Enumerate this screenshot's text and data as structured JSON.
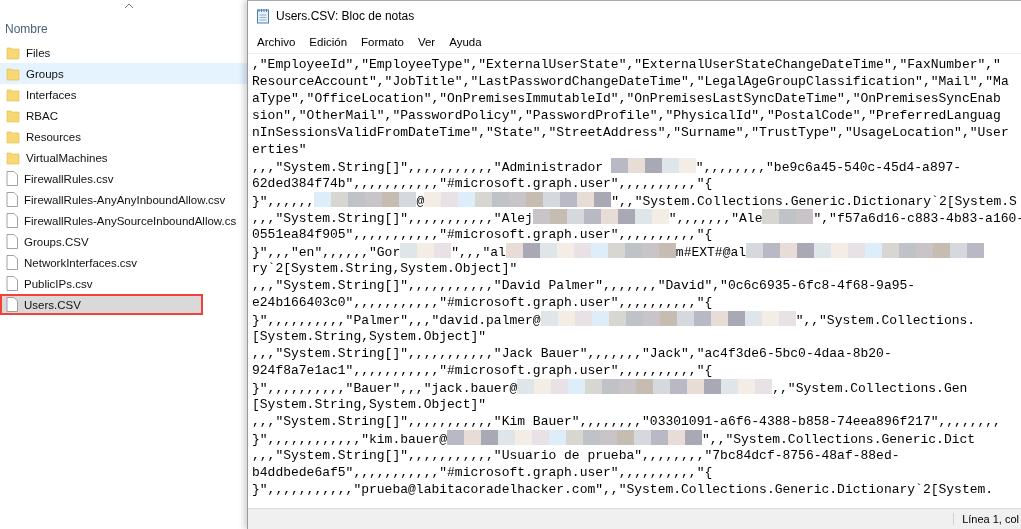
{
  "explorer": {
    "column_header": "Nombre",
    "items": [
      {
        "kind": "folder",
        "name": "Files",
        "hovered": false,
        "selected": false,
        "highlighted": false
      },
      {
        "kind": "folder",
        "name": "Groups",
        "hovered": true,
        "selected": false,
        "highlighted": false
      },
      {
        "kind": "folder",
        "name": "Interfaces",
        "hovered": false,
        "selected": false,
        "highlighted": false
      },
      {
        "kind": "folder",
        "name": "RBAC",
        "hovered": false,
        "selected": false,
        "highlighted": false
      },
      {
        "kind": "folder",
        "name": "Resources",
        "hovered": false,
        "selected": false,
        "highlighted": false
      },
      {
        "kind": "folder",
        "name": "VirtualMachines",
        "hovered": false,
        "selected": false,
        "highlighted": false
      },
      {
        "kind": "file",
        "name": "FirewallRules.csv",
        "hovered": false,
        "selected": false,
        "highlighted": false
      },
      {
        "kind": "file",
        "name": "FirewallRules-AnyAnyInboundAllow.csv",
        "hovered": false,
        "selected": false,
        "highlighted": false
      },
      {
        "kind": "file",
        "name": "FirewallRules-AnySourceInboundAllow.cs",
        "hovered": false,
        "selected": false,
        "highlighted": false
      },
      {
        "kind": "file",
        "name": "Groups.CSV",
        "hovered": false,
        "selected": false,
        "highlighted": false
      },
      {
        "kind": "file",
        "name": "NetworkInterfaces.csv",
        "hovered": false,
        "selected": false,
        "highlighted": false
      },
      {
        "kind": "file",
        "name": "PublicIPs.csv",
        "hovered": false,
        "selected": false,
        "highlighted": false
      },
      {
        "kind": "file",
        "name": "Users.CSV",
        "hovered": false,
        "selected": true,
        "highlighted": true
      }
    ]
  },
  "notepad": {
    "title": "Users.CSV: Bloc de notas",
    "menu": [
      "Archivo",
      "Edición",
      "Formato",
      "Ver",
      "Ayuda"
    ],
    "lines": [
      [
        {
          "kind": "text",
          "text": ",\"EmployeeId\",\"EmployeeType\",\"ExternalUserState\",\"ExternalUserStateChangeDateTime\",\"FaxNumber\",\""
        }
      ],
      [
        {
          "kind": "text",
          "text": "ResourceAccount\",\"JobTitle\",\"LastPasswordChangeDateTime\",\"LegalAgeGroupClassification\",\"Mail\",\"Ma"
        }
      ],
      [
        {
          "kind": "text",
          "text": "aType\",\"OfficeLocation\",\"OnPremisesImmutableId\",\"OnPremisesLastSyncDateTime\",\"OnPremisesSyncEnab"
        }
      ],
      [
        {
          "kind": "text",
          "text": "sion\",\"OtherMail\",\"PasswordPolicy\",\"PasswordProfile\",\"PhysicalId\",\"PostalCode\",\"PreferredLanguag"
        }
      ],
      [
        {
          "kind": "text",
          "text": "nInSessionsValidFromDateTime\",\"State\",\"StreetAddress\",\"Surname\",\"TrustType\",\"UsageLocation\",\"User"
        }
      ],
      [
        {
          "kind": "text",
          "text": "erties\""
        }
      ],
      [
        {
          "kind": "text",
          "text": ",,,\"System.String[]\",,,,,,,,,,,\"Administrador "
        },
        {
          "kind": "redacted"
        },
        {
          "kind": "text",
          "text": "\",,,,,,,,\"be9c6a45-540c-45d4-a897-"
        }
      ],
      [
        {
          "kind": "text",
          "text": "62ded384f74b\",,,,,,,,,,,\"#microsoft.graph.user\",,,,,,,,,,\"{"
        }
      ],
      [
        {
          "kind": "text",
          "text": "}\",,,,,,"
        },
        {
          "kind": "redacted"
        },
        {
          "kind": "text",
          "text": "@"
        },
        {
          "kind": "redacted"
        },
        {
          "kind": "text",
          "text": "\",,\"System.Collections.Generic.Dictionary`2[System.S"
        }
      ],
      [
        {
          "kind": "text",
          "text": ",,,\"System.String[]\",,,,,,,,,,,\"Alej"
        },
        {
          "kind": "redacted"
        },
        {
          "kind": "text",
          "text": "\",,,,,,,\"Ale"
        },
        {
          "kind": "redacted"
        },
        {
          "kind": "text",
          "text": "\",\"f57a6d16-c883-4b83-a160-"
        }
      ],
      [
        {
          "kind": "text",
          "text": "0551ea84f905\",,,,,,,,,,,\"#microsoft.graph.user\",,,,,,,,,,\"{"
        }
      ],
      [
        {
          "kind": "text",
          "text": "}\",,,\"en\",,,,,,\"Gor"
        },
        {
          "kind": "redacted"
        },
        {
          "kind": "text",
          "text": "\",,,\"al"
        },
        {
          "kind": "redacted"
        },
        {
          "kind": "text",
          "text": "m#EXT#@al"
        },
        {
          "kind": "redacted"
        }
      ],
      [
        {
          "kind": "text",
          "text": "ry`2[System.String,System.Object]\""
        }
      ],
      [
        {
          "kind": "text",
          "text": ",,,\"System.String[]\",,,,,,,,,,,\"David Palmer\",,,,,,,\"David\",\"0c6c6935-6fc8-4f68-9a95-"
        }
      ],
      [
        {
          "kind": "text",
          "text": "e24b166403c0\",,,,,,,,,,,\"#microsoft.graph.user\",,,,,,,,,,\"{"
        }
      ],
      [
        {
          "kind": "text",
          "text": "}\",,,,,,,,,,\"Palmer\",,,\"david.palmer@"
        },
        {
          "kind": "redacted"
        },
        {
          "kind": "text",
          "text": "\",,\"System.Collections."
        }
      ],
      [
        {
          "kind": "text",
          "text": "[System.String,System.Object]\""
        }
      ],
      [
        {
          "kind": "text",
          "text": ",,,\"System.String[]\",,,,,,,,,,,\"Jack Bauer\",,,,,,,\"Jack\",\"ac4f3de6-5bc0-4daa-8b20-"
        }
      ],
      [
        {
          "kind": "text",
          "text": "924f8a7e1ac1\",,,,,,,,,,,\"#microsoft.graph.user\",,,,,,,,,,\"{"
        }
      ],
      [
        {
          "kind": "text",
          "text": "}\",,,,,,,,,,\"Bauer\",,,\"jack.bauer@"
        },
        {
          "kind": "redacted"
        },
        {
          "kind": "text",
          "text": ",,\"System.Collections.Gen"
        }
      ],
      [
        {
          "kind": "text",
          "text": "[System.String,System.Object]\""
        }
      ],
      [
        {
          "kind": "text",
          "text": ",,,\"System.String[]\",,,,,,,,,,,\"Kim Bauer\",,,,,,,,\"03301091-a6f6-4388-b858-74eea896f217\",,,,,,,,"
        }
      ],
      [
        {
          "kind": "text",
          "text": "}\",,,,,,,,,,,,\"kim.bauer@"
        },
        {
          "kind": "redacted"
        },
        {
          "kind": "text",
          "text": "\",,\"System.Collections.Generic.Dict"
        }
      ],
      [
        {
          "kind": "text",
          "text": ",,,\"System.String[]\",,,,,,,,,,,\"Usuario de prueba\",,,,,,,,\"7bc84dcf-8756-48af-88ed-"
        }
      ],
      [
        {
          "kind": "text",
          "text": "b4ddbede6af5\",,,,,,,,,,,\"#microsoft.graph.user\",,,,,,,,,,\"{"
        }
      ],
      [
        {
          "kind": "text",
          "text": "}\",,,,,,,,,,,\"prueba@labitacoradelhacker.com\",,\"System.Collections.Generic.Dictionary`2[System."
        }
      ]
    ],
    "status_bar": "Línea 1, col"
  }
}
